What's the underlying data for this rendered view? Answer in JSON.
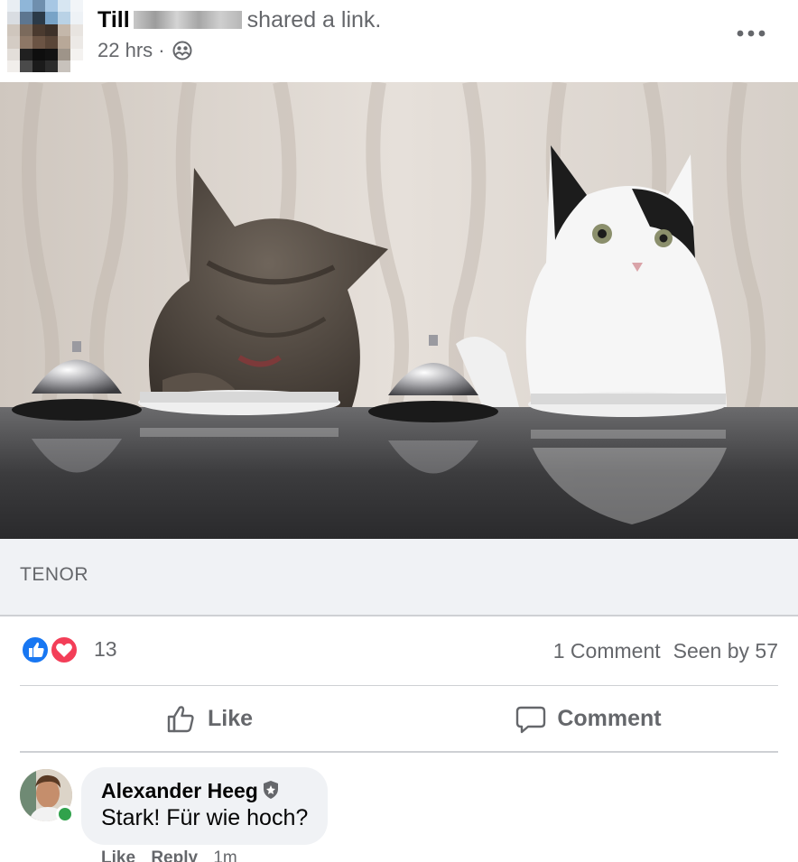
{
  "post": {
    "author_first_name": "Till",
    "shared_text": "shared a link.",
    "timestamp": "22 hrs",
    "meta_separator": "·",
    "audience_icon": "friends-icon",
    "more_icon": "more-options-icon"
  },
  "media": {
    "source": "TENOR"
  },
  "reactions": {
    "icons": [
      "like-reaction-icon",
      "love-reaction-icon"
    ],
    "count": "13",
    "comments": "1 Comment",
    "seen_by": "Seen by 57"
  },
  "actions": {
    "like_label": "Like",
    "comment_label": "Comment"
  },
  "comment": {
    "author": "Alexander Heeg",
    "text": "Stark! Für wie hoch?",
    "like_label": "Like",
    "reply_label": "Reply",
    "time": "1m"
  },
  "colors": {
    "secondary_text": "#65676b",
    "like_blue": "#1877f2",
    "love_red": "#f33e58",
    "online_green": "#31a24c",
    "bubble_bg": "#f0f2f5"
  }
}
